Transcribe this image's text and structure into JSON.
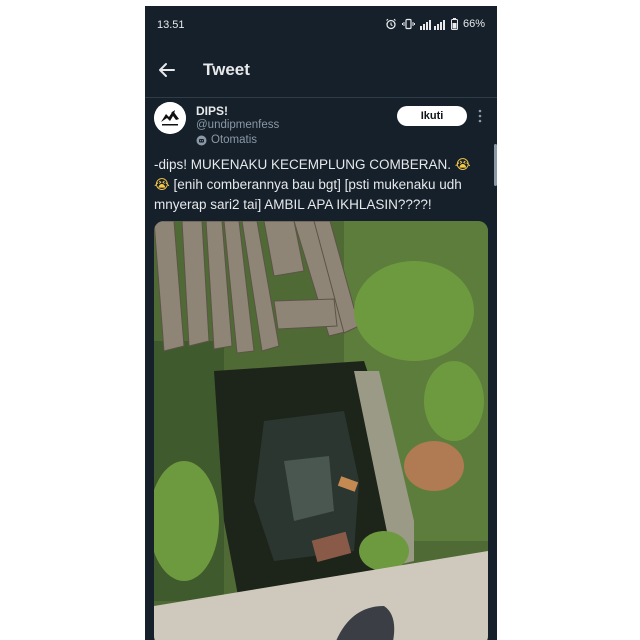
{
  "status_bar": {
    "time": "13.51",
    "battery": "66%",
    "icons": [
      "alarm-icon",
      "vibrate-icon",
      "signal-icon",
      "battery-icon"
    ]
  },
  "header": {
    "title": "Tweet",
    "back_icon": "arrow-left-icon"
  },
  "tweet": {
    "author": {
      "display_name": "DIPS!",
      "handle": "@undipmenfess",
      "automated_label": "Otomatis",
      "avatar_icon": "logo-avatar"
    },
    "follow_label": "Ikuti",
    "text_line1": "-dips! MUKENAKU KECEMPLUNG COMBERAN.",
    "text_line2": "[enih comberannya bau bgt] [psti mukenaku udh mnyerap sari2 tai] AMBIL APA IKHLASIN????!",
    "emoji": "😭",
    "media_description_icon": "photo-media"
  },
  "colors": {
    "background": "#15202b",
    "text": "#e7e9ea",
    "muted": "#8b98a5",
    "follow_bg": "#ffffff"
  }
}
